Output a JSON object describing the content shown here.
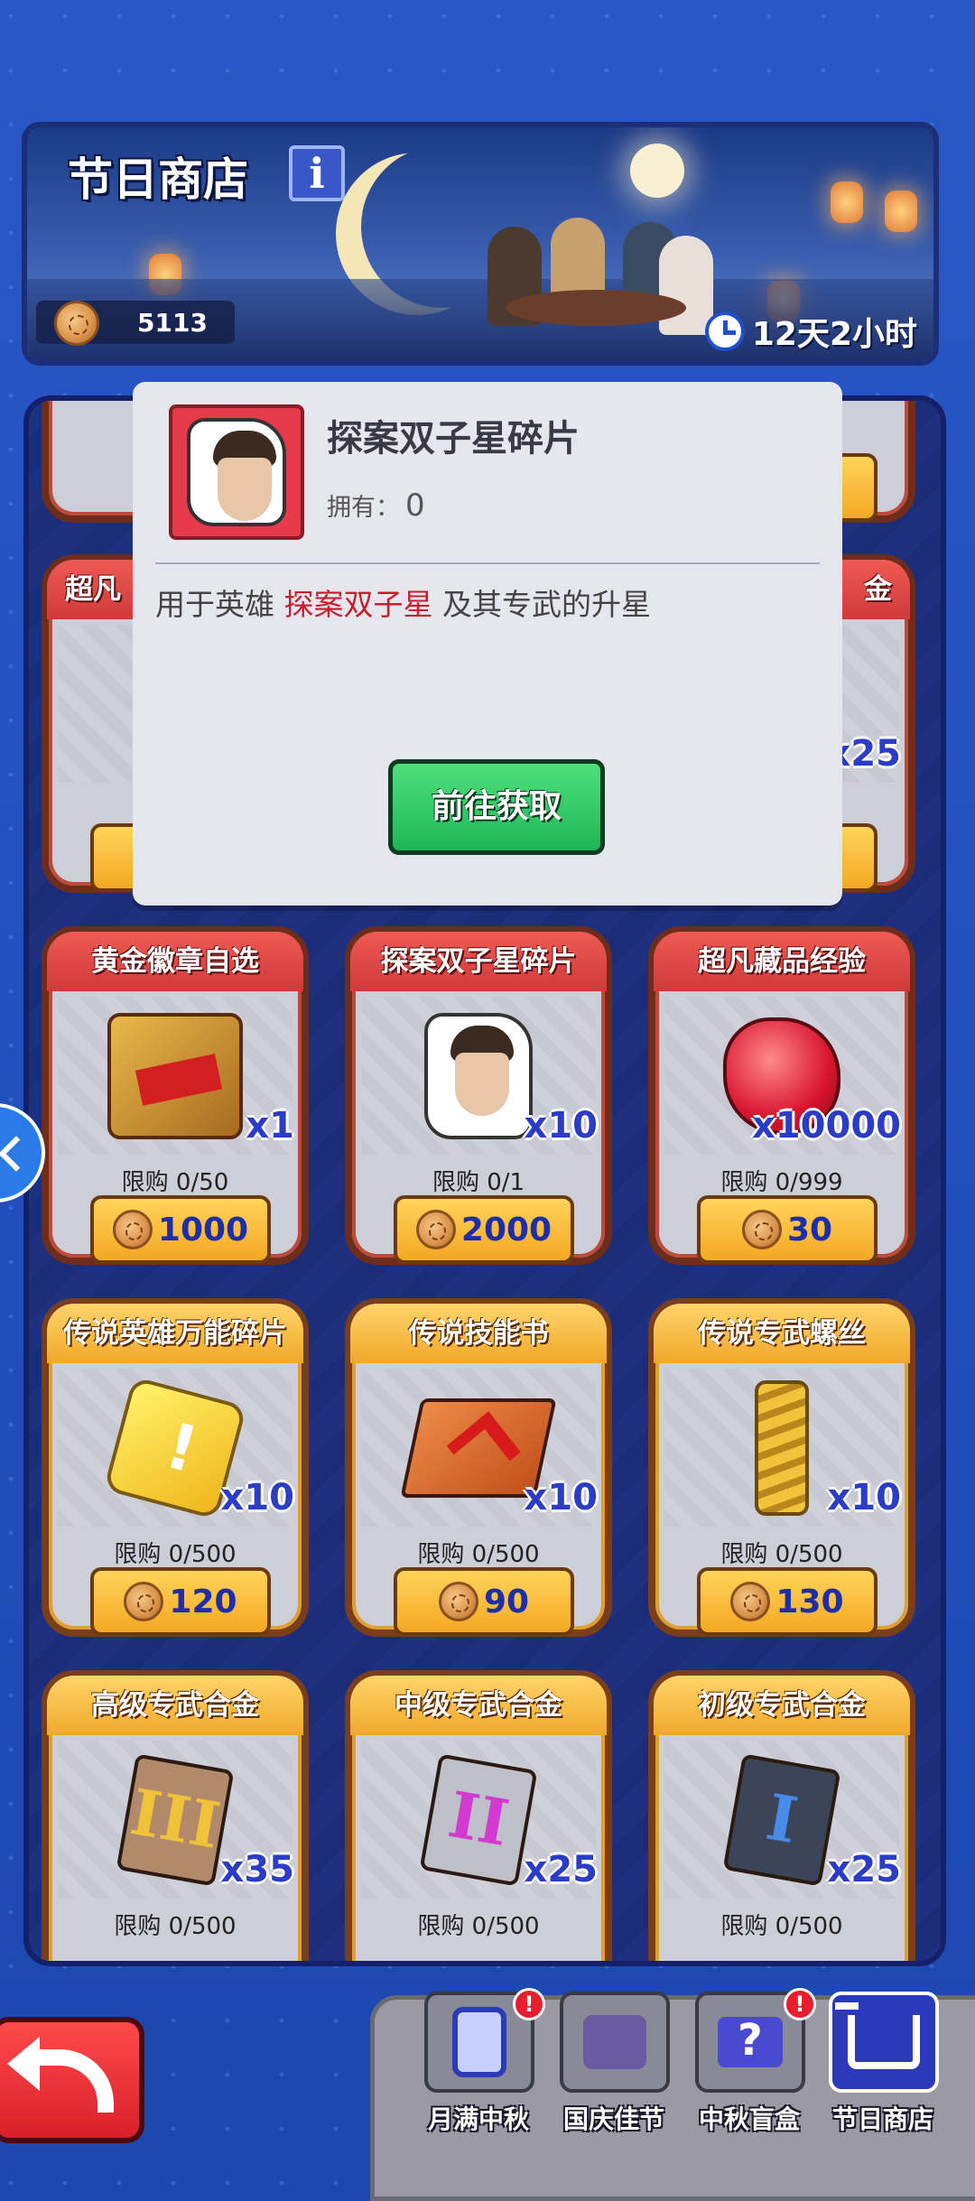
{
  "banner": {
    "title": "节日商店",
    "info_label": "i",
    "coins": "5113",
    "timer": "12天2小时"
  },
  "popup": {
    "title": "探案双子星碎片",
    "owned_label": "拥有：",
    "owned_value": "0",
    "desc_prefix": "用于英雄 ",
    "desc_highlight": "探案双子星",
    "desc_suffix": " 及其专武的升星",
    "button_label": "前往获取"
  },
  "partial_row": {
    "left_header": "超凡",
    "right_header": "金",
    "right_qty": "x25"
  },
  "shop": {
    "cards": [
      {
        "name": "黄金徽章自选",
        "qty": "x1",
        "limit": "限购 0/50",
        "price": "1000",
        "style": "red",
        "art": "badge"
      },
      {
        "name": "探案双子星碎片",
        "qty": "x10",
        "limit": "限购 0/1",
        "price": "2000",
        "style": "red",
        "art": "portrait"
      },
      {
        "name": "超凡藏品经验",
        "qty": "x10000",
        "limit": "限购 0/999",
        "price": "30",
        "style": "red",
        "art": "gem"
      },
      {
        "name": "传说英雄万能碎片",
        "qty": "x10",
        "limit": "限购 0/500",
        "price": "120",
        "style": "gold",
        "art": "puzzle"
      },
      {
        "name": "传说技能书",
        "qty": "x10",
        "limit": "限购 0/500",
        "price": "90",
        "style": "gold",
        "art": "book"
      },
      {
        "name": "传说专武螺丝",
        "qty": "x10",
        "limit": "限购 0/500",
        "price": "130",
        "style": "gold",
        "art": "screw"
      },
      {
        "name": "高级专武合金",
        "qty": "x35",
        "limit": "限购 0/500",
        "price": "",
        "style": "gold",
        "art": "alloy-3",
        "art_text": "III"
      },
      {
        "name": "中级专武合金",
        "qty": "x25",
        "limit": "限购 0/500",
        "price": "",
        "style": "gold",
        "art": "alloy-2",
        "art_text": "II"
      },
      {
        "name": "初级专武合金",
        "qty": "x25",
        "limit": "限购 0/500",
        "price": "",
        "style": "gold",
        "art": "alloy-1",
        "art_text": "I"
      }
    ]
  },
  "nav": {
    "tabs": [
      {
        "label": "月满中秋",
        "alert": "!",
        "icon": "calendar-icon"
      },
      {
        "label": "国庆佳节",
        "alert": "",
        "icon": "cheers-icon"
      },
      {
        "label": "中秋盲盒",
        "alert": "!",
        "icon": "mystery-box-icon"
      },
      {
        "label": "节日商店",
        "alert": "",
        "icon": "cart-icon"
      }
    ]
  }
}
